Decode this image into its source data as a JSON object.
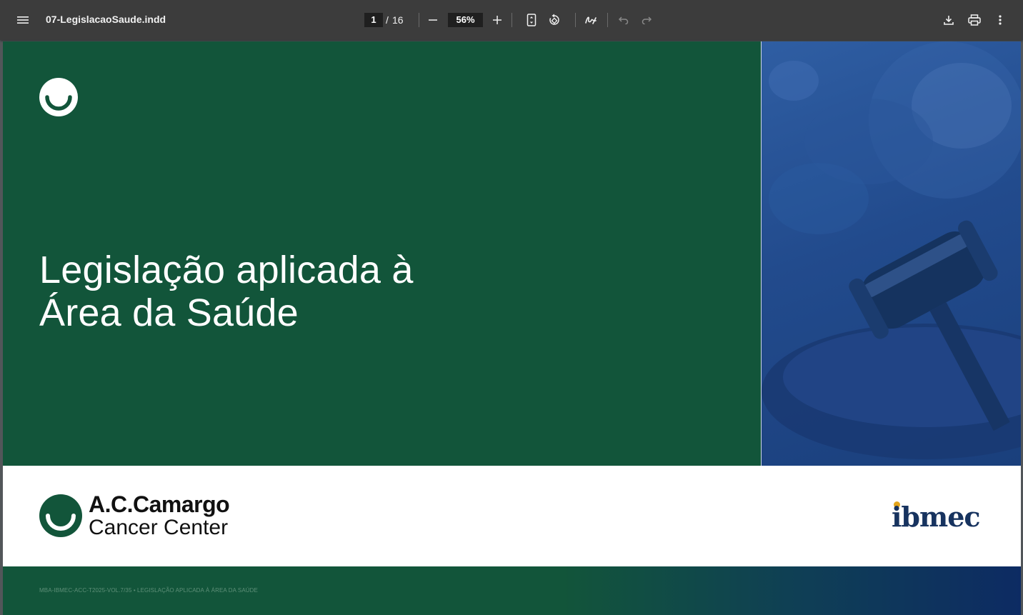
{
  "toolbar": {
    "document_title": "07-LegislacaoSaude.indd",
    "current_page": "1",
    "page_separator": "/",
    "total_pages": "16",
    "zoom": "56%",
    "icons": [
      "menu-icon",
      "zoom-out-icon",
      "zoom-in-icon",
      "fit-page-icon",
      "rotate-icon",
      "annotate-icon",
      "undo-icon",
      "redo-icon",
      "download-icon",
      "print-icon",
      "more-options-icon"
    ]
  },
  "page": {
    "title_line1": "Legislação aplicada à",
    "title_line2": "Área da Saúde",
    "logo_name": "A.C.Camargo",
    "logo_subtitle": "Cancer Center",
    "partner_logo": "ibmec",
    "footer": "MBA-IBMEC-ACC-T2025-VOL.7/35 • LEGISLAÇÃO APLICADA À ÁREA DA SAÚDE"
  },
  "colors": {
    "toolbar_bg": "#3c3c3c",
    "cover_green": "#12553a",
    "photo_blue": "#224b8d",
    "ibmec_navy": "#17335f",
    "ibmec_accent": "#e3a41b"
  }
}
